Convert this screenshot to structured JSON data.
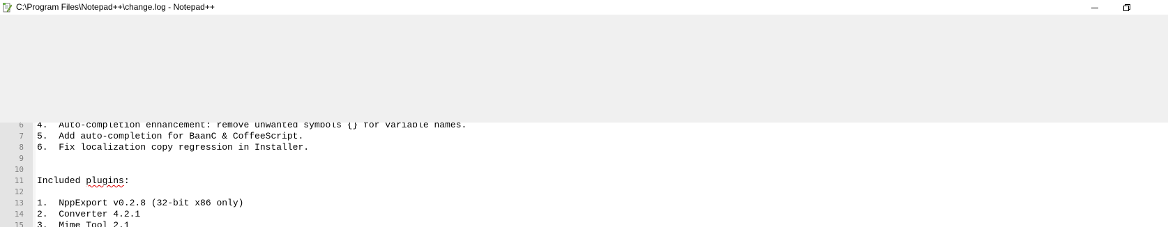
{
  "window": {
    "title": "C:\\Program Files\\Notepad++\\change.log - Notepad++",
    "icons": {
      "app": "notepad-plus-plus-icon",
      "minimize": "minimize-icon",
      "maximize": "restore-icon"
    }
  },
  "editor": {
    "lines": [
      {
        "number": "6",
        "text": "4.  Auto-completion enhancement: remove unwanted symbols {} for variable names."
      },
      {
        "number": "7",
        "text": "5.  Add auto-completion for BaanC & CoffeeScript."
      },
      {
        "number": "8",
        "text": "6.  Fix localization copy regression in Installer."
      },
      {
        "number": "9",
        "text": ""
      },
      {
        "number": "10",
        "text": ""
      },
      {
        "number": "11",
        "text_before": "Included ",
        "text_flagged": "plugins",
        "text_after": ":"
      },
      {
        "number": "12",
        "text": ""
      },
      {
        "number": "13",
        "text": "1.  NppExport v0.2.8 (32-bit x86 only)"
      },
      {
        "number": "14",
        "text": "2.  Converter 4.2.1"
      },
      {
        "number": "15",
        "text": "3.  Mime Tool 2.1"
      }
    ],
    "spellcheck_color": "#e00000"
  }
}
